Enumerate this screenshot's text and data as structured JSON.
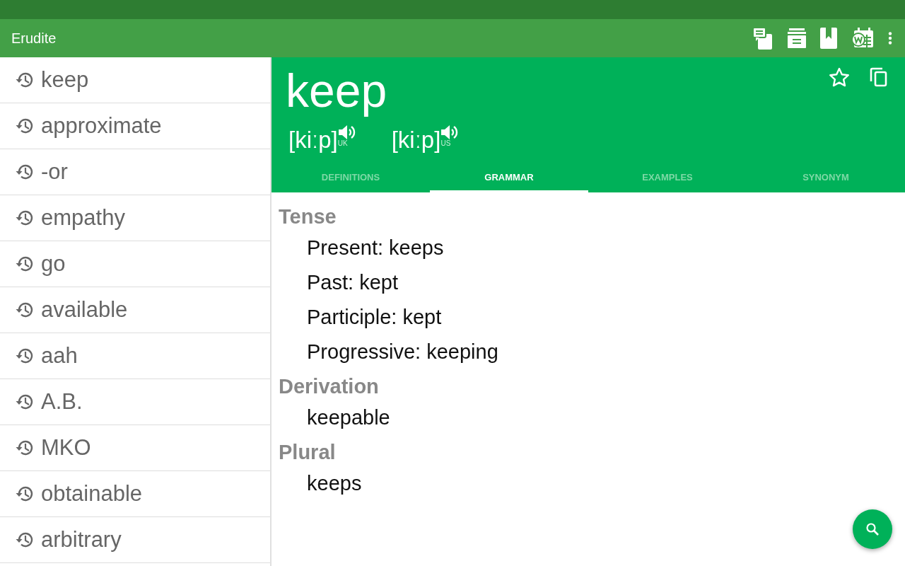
{
  "app_bar": {
    "title": "Erudite"
  },
  "history": [
    "keep",
    "approximate",
    "-or",
    "empathy",
    "go",
    "available",
    "aah",
    "A.B.",
    "MKO",
    "obtainable",
    "arbitrary"
  ],
  "entry": {
    "word": "keep",
    "pronunciations": [
      {
        "ipa": "[kiːp]",
        "region": "UK"
      },
      {
        "ipa": "[kiːp]",
        "region": "US"
      }
    ]
  },
  "tabs": [
    {
      "label": "DEFINITIONS",
      "selected": false
    },
    {
      "label": "GRAMMAR",
      "selected": true
    },
    {
      "label": "EXAMPLES",
      "selected": false
    },
    {
      "label": "SYNONYM",
      "selected": false
    }
  ],
  "sections": [
    {
      "heading": "Tense",
      "items": [
        "Present: keeps",
        "Past: kept",
        "Participle: kept",
        "Progressive: keeping"
      ]
    },
    {
      "heading": "Derivation",
      "items": [
        "keepable"
      ]
    },
    {
      "heading": "Plural",
      "items": [
        "keeps"
      ]
    }
  ]
}
